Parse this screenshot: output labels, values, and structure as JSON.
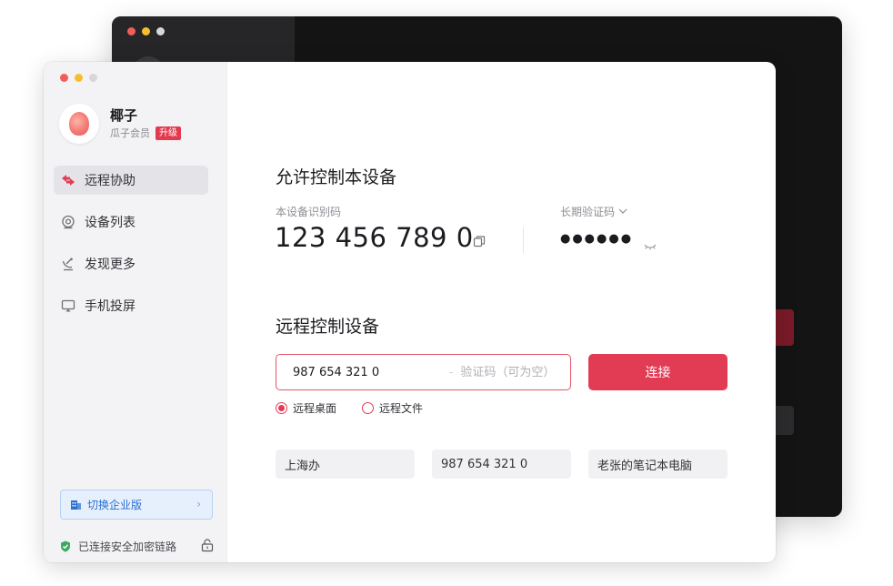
{
  "user": {
    "name": "椰子",
    "membership": "瓜子会员",
    "upgrade": "升级"
  },
  "sidebar": {
    "items": [
      {
        "label": "远程协助",
        "active": true
      },
      {
        "label": "设备列表",
        "active": false
      },
      {
        "label": "发现更多",
        "active": false
      },
      {
        "label": "手机投屏",
        "active": false
      }
    ],
    "enterprise_label": "切换企业版",
    "secure_status": "已连接安全加密链路"
  },
  "allow_control": {
    "title": "允许控制本设备",
    "device_id_label": "本设备识别码",
    "device_id": "123 456 789 0",
    "code_label": "长期验证码",
    "code_masked": "●●●●●●"
  },
  "remote_control": {
    "title": "远程控制设备",
    "id_value": "987 654 321 0",
    "code_placeholder": "验证码（可为空）",
    "dash": "-",
    "connect_label": "连接",
    "modes": [
      {
        "label": "远程桌面",
        "selected": true
      },
      {
        "label": "远程文件",
        "selected": false
      }
    ],
    "history": [
      "上海办",
      "987 654 321 0",
      "老张的笔记本电脑"
    ]
  },
  "colors": {
    "accent": "#e23c55",
    "enterprise_text": "#2c6fcf",
    "secure_green": "#3aaa5c"
  },
  "icons": {
    "nav": [
      "swap-arrows-icon",
      "device-list-icon",
      "discover-icon",
      "screen-cast-icon"
    ],
    "copy": "copy-icon",
    "eye": "eye-closed-icon",
    "lock": "lock-icon",
    "shield": "shield-check-icon",
    "building": "building-icon"
  }
}
